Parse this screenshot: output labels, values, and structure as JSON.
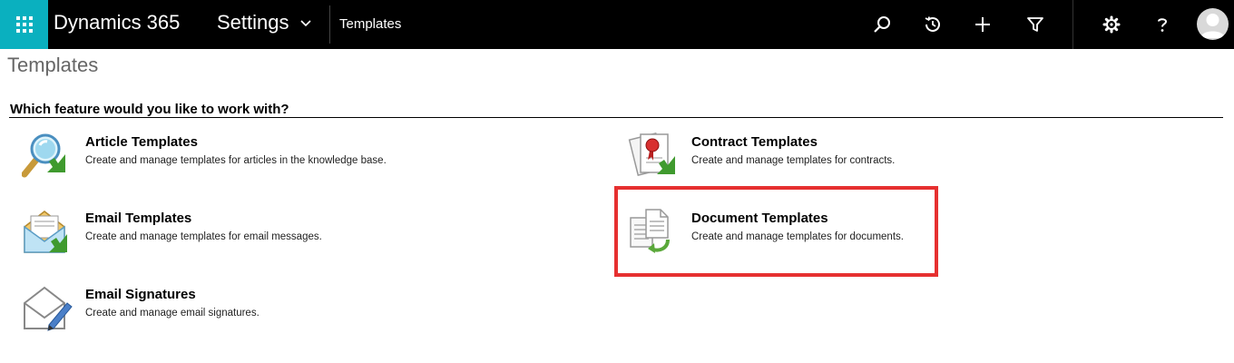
{
  "topbar": {
    "brand": "Dynamics 365",
    "area": "Settings",
    "breadcrumb": "Templates",
    "waffle_color": "#0ab0bf"
  },
  "icons": [
    "waffle-icon",
    "chevron-down-icon",
    "search-icon",
    "history-icon",
    "plus-icon",
    "filter-icon",
    "gear-icon",
    "help-icon",
    "avatar-icon"
  ],
  "page": {
    "title": "Templates",
    "question": "Which feature would you like to work with?"
  },
  "features": {
    "article": {
      "title": "Article Templates",
      "desc": "Create and manage templates for articles in the knowledge base."
    },
    "email": {
      "title": "Email Templates",
      "desc": "Create and manage templates for email messages."
    },
    "signature": {
      "title": "Email Signatures",
      "desc": "Create and manage email signatures."
    },
    "contract": {
      "title": "Contract Templates",
      "desc": "Create and manage templates for contracts."
    },
    "document": {
      "title": "Document Templates",
      "desc": "Create and manage templates for documents."
    }
  },
  "highlight_color": "#e63030"
}
